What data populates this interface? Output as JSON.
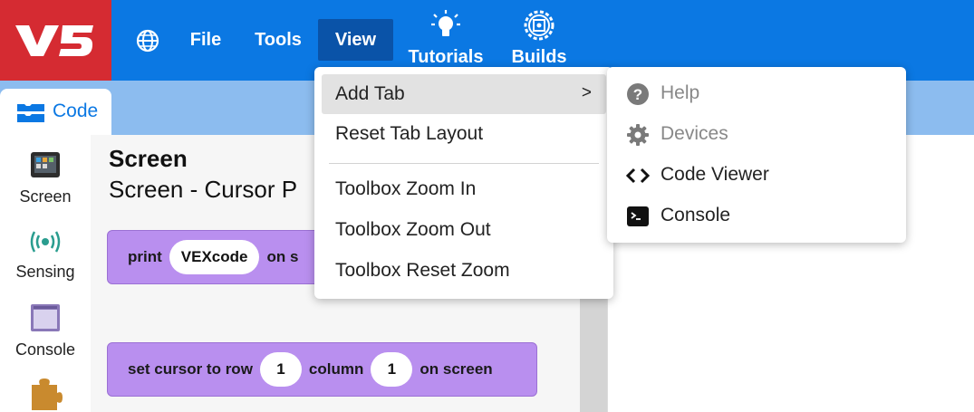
{
  "colors": {
    "topbar": "#0b78e3",
    "logo_bg": "#d52b32",
    "subbar": "#8cbcef",
    "block": "#b98fef",
    "highlight": "#e2e2e2"
  },
  "logo": {
    "text": "V5"
  },
  "menubar": {
    "file": "File",
    "tools": "Tools",
    "view": "View",
    "tutorials": "Tutorials",
    "builds": "Builds"
  },
  "code_tab": {
    "label": "Code"
  },
  "categories": [
    {
      "label": "Screen",
      "icon": "brain-screen-icon"
    },
    {
      "label": "Sensing",
      "icon": "sensing-icon"
    },
    {
      "label": "Console",
      "icon": "console-window-icon"
    },
    {
      "label": "",
      "icon": "puzzle-piece-icon"
    }
  ],
  "workspace": {
    "title": "Screen",
    "subtitle": "Screen - Cursor P",
    "block1": {
      "prefix": "print",
      "value": "VEXcode",
      "suffix": "on s"
    },
    "block2": {
      "prefix": "set cursor to row",
      "row": "1",
      "middle": "column",
      "column": "1",
      "suffix": "on screen"
    }
  },
  "view_menu": {
    "items": [
      "Add Tab",
      "Reset Tab Layout",
      "Toolbox Zoom In",
      "Toolbox Zoom Out",
      "Toolbox Reset Zoom"
    ],
    "submenu_arrow": ">"
  },
  "add_tab_submenu": {
    "items": [
      {
        "label": "Help",
        "icon": "help-icon",
        "disabled": true
      },
      {
        "label": "Devices",
        "icon": "gear-icon",
        "disabled": true
      },
      {
        "label": "Code Viewer",
        "icon": "code-brackets-icon",
        "disabled": false
      },
      {
        "label": "Console",
        "icon": "terminal-icon",
        "disabled": false
      }
    ]
  }
}
